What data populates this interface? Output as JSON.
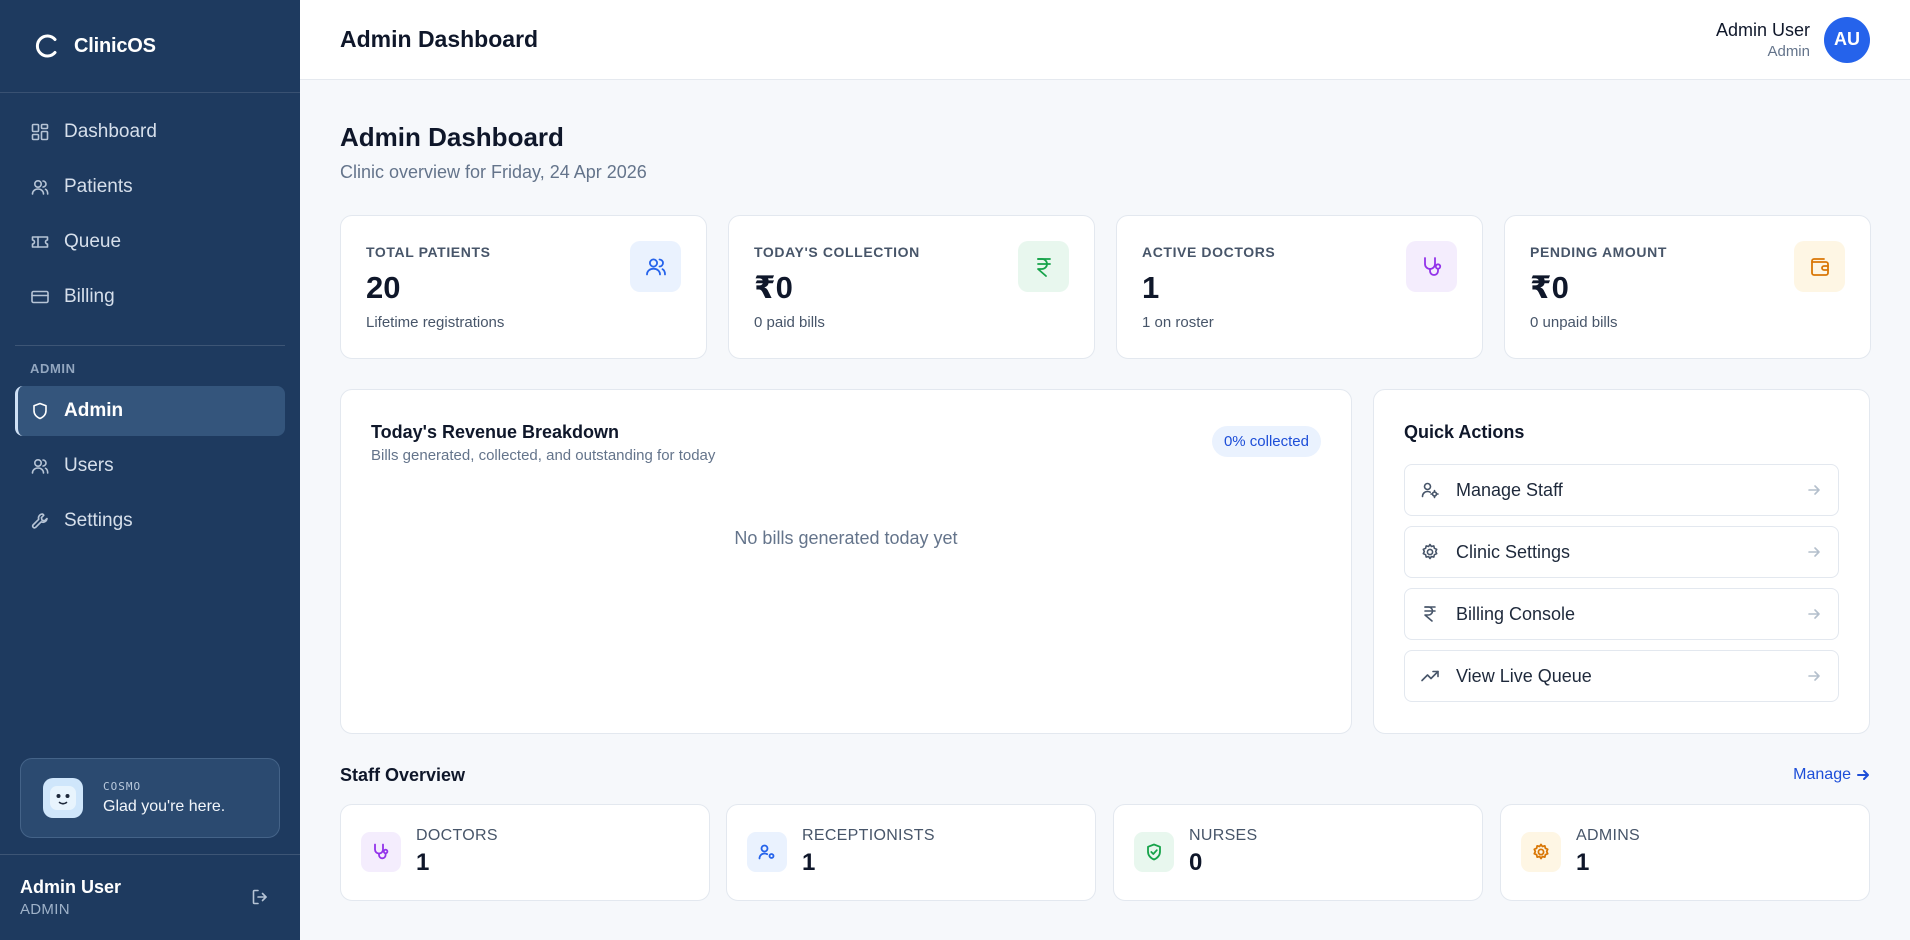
{
  "app": {
    "name": "ClinicOS"
  },
  "sidebar": {
    "items": [
      {
        "label": "Dashboard",
        "icon": "grid-icon"
      },
      {
        "label": "Patients",
        "icon": "users-icon"
      },
      {
        "label": "Queue",
        "icon": "ticket-icon"
      },
      {
        "label": "Billing",
        "icon": "credit-card-icon"
      }
    ],
    "section_label": "ADMIN",
    "admin_items": [
      {
        "label": "Admin",
        "icon": "shield-icon",
        "active": true
      },
      {
        "label": "Users",
        "icon": "users-icon"
      },
      {
        "label": "Settings",
        "icon": "wrench-icon"
      }
    ],
    "cosmo": {
      "tag": "COSMO",
      "message": "Glad you're here."
    },
    "footer": {
      "name": "Admin User",
      "role": "ADMIN"
    }
  },
  "topbar": {
    "title": "Admin Dashboard",
    "user_name": "Admin User",
    "user_role": "Admin",
    "avatar_initials": "AU"
  },
  "page": {
    "title": "Admin Dashboard",
    "subtitle": "Clinic overview for Friday, 24 Apr 2026"
  },
  "stats": [
    {
      "label": "TOTAL PATIENTS",
      "value": "20",
      "desc": "Lifetime registrations",
      "icon": "users-icon",
      "color": "#2563eb",
      "bg": "#eaf2fe"
    },
    {
      "label": "TODAY'S COLLECTION",
      "value": "₹0",
      "desc": "0 paid bills",
      "icon": "rupee-icon",
      "color": "#16a34a",
      "bg": "#e8f7ee"
    },
    {
      "label": "ACTIVE DOCTORS",
      "value": "1",
      "desc": "1 on roster",
      "icon": "stethoscope-icon",
      "color": "#9333ea",
      "bg": "#f4edfd"
    },
    {
      "label": "PENDING AMOUNT",
      "value": "₹0",
      "desc": "0 unpaid bills",
      "icon": "wallet-icon",
      "color": "#d97706",
      "bg": "#fef6e4"
    }
  ],
  "revenue": {
    "title": "Today's Revenue Breakdown",
    "subtitle": "Bills generated, collected, and outstanding for today",
    "badge": "0% collected",
    "empty": "No bills generated today yet"
  },
  "quick_actions": {
    "title": "Quick Actions",
    "items": [
      {
        "label": "Manage Staff",
        "icon": "user-gear-icon"
      },
      {
        "label": "Clinic Settings",
        "icon": "gear-icon"
      },
      {
        "label": "Billing Console",
        "icon": "rupee-icon"
      },
      {
        "label": "View Live Queue",
        "icon": "trending-up-icon"
      }
    ]
  },
  "staff": {
    "title": "Staff Overview",
    "manage_label": "Manage",
    "cards": [
      {
        "label": "DOCTORS",
        "value": "1",
        "icon": "stethoscope-icon",
        "color": "#9333ea",
        "bg": "#f4edfd"
      },
      {
        "label": "RECEPTIONISTS",
        "value": "1",
        "icon": "user-gear-icon",
        "color": "#2563eb",
        "bg": "#eaf2fe"
      },
      {
        "label": "NURSES",
        "value": "0",
        "icon": "shield-check-icon",
        "color": "#16a34a",
        "bg": "#e8f7ee"
      },
      {
        "label": "ADMINS",
        "value": "1",
        "icon": "gear-icon",
        "color": "#d97706",
        "bg": "#fef6e4"
      }
    ]
  }
}
